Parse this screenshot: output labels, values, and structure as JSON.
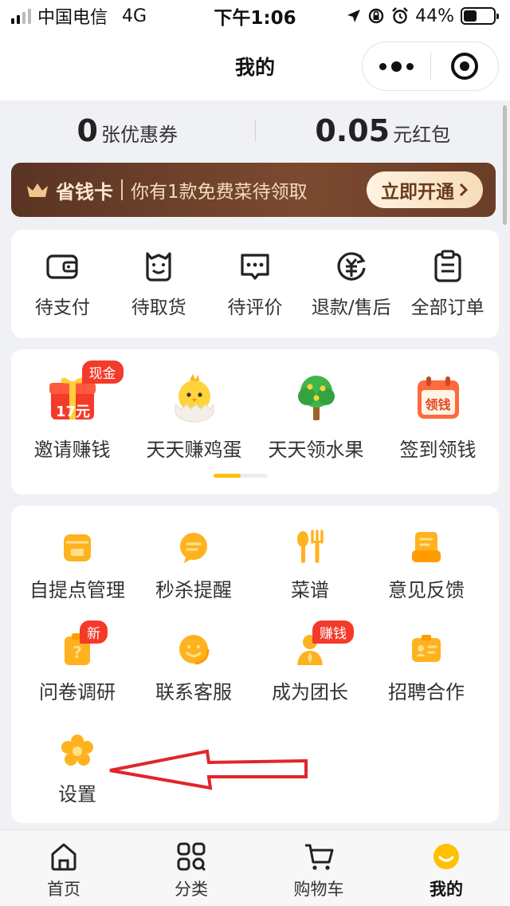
{
  "status_bar": {
    "carrier": "中国电信",
    "network": "4G",
    "time": "下午1:06",
    "battery": "44%",
    "battery_level": 0.44
  },
  "nav": {
    "title": "我的",
    "more_icon": "more-dots-icon",
    "close_icon": "target-icon"
  },
  "assets": {
    "coupons": {
      "value": "0",
      "unit": "张优惠券"
    },
    "redpacket": {
      "value": "0.05",
      "unit": "元红包"
    }
  },
  "vip": {
    "name": "省钱卡",
    "tip": "你有1款免费菜待领取",
    "button": "立即开通"
  },
  "orders": [
    {
      "label": "待支付",
      "icon": "wallet-icon"
    },
    {
      "label": "待取货",
      "icon": "bag-icon"
    },
    {
      "label": "待评价",
      "icon": "comment-icon"
    },
    {
      "label": "退款/售后",
      "icon": "refund-icon"
    },
    {
      "label": "全部订单",
      "icon": "clipboard-icon"
    }
  ],
  "games": [
    {
      "label": "邀请赚钱",
      "icon": "gift-icon",
      "badge": "现金",
      "gift_text": "17元"
    },
    {
      "label": "天天赚鸡蛋",
      "icon": "chick-icon"
    },
    {
      "label": "天天领水果",
      "icon": "tree-icon"
    },
    {
      "label": "签到领钱",
      "icon": "calendar-icon",
      "calendar_text": "领钱"
    }
  ],
  "games_pager": {
    "active": 1,
    "total": 2
  },
  "tools": [
    {
      "label": "自提点管理",
      "icon": "store-icon"
    },
    {
      "label": "秒杀提醒",
      "icon": "chat-bubble-icon"
    },
    {
      "label": "菜谱",
      "icon": "utensils-icon"
    },
    {
      "label": "意见反馈",
      "icon": "feedback-icon"
    },
    {
      "label": "问卷调研",
      "icon": "survey-icon",
      "badge": "新"
    },
    {
      "label": "联系客服",
      "icon": "service-icon"
    },
    {
      "label": "成为团长",
      "icon": "leader-icon",
      "badge": "赚钱"
    },
    {
      "label": "招聘合作",
      "icon": "id-card-icon"
    },
    {
      "label": "设置",
      "icon": "settings-flower-icon"
    }
  ],
  "tabbar": [
    {
      "label": "首页",
      "icon": "home-icon"
    },
    {
      "label": "分类",
      "icon": "category-icon"
    },
    {
      "label": "购物车",
      "icon": "cart-icon"
    },
    {
      "label": "我的",
      "icon": "profile-icon",
      "active": true
    }
  ],
  "colors": {
    "accent": "#ffc000",
    "vip_bg": "#6a3d28",
    "badge": "#f43a2a",
    "annotation_arrow": "#e0262a"
  }
}
